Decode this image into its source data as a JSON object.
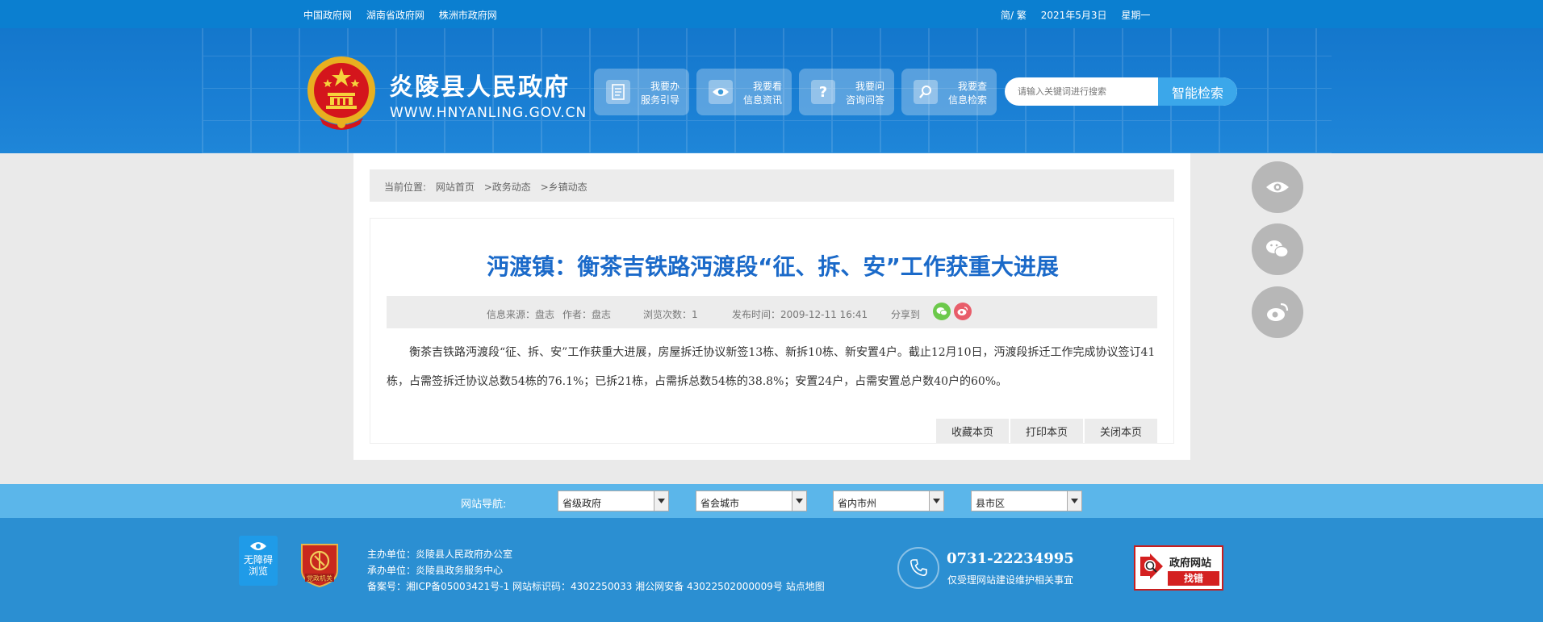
{
  "topbar": {
    "links": [
      "中国政府网",
      "湖南省政府网",
      "株洲市政府网"
    ],
    "lang": "简/ 繁",
    "date": "2021年5月3日",
    "weekday": "星期一"
  },
  "header": {
    "site_name": "炎陵县人民政府",
    "site_url": "WWW.HNYANLING.GOV.CN",
    "services": [
      {
        "line1": "我要办",
        "line2": "服务引导",
        "icon": "document-icon"
      },
      {
        "line1": "我要看",
        "line2": "信息资讯",
        "icon": "eye-icon"
      },
      {
        "line1": "我要问",
        "line2": "咨询问答",
        "icon": "question-icon"
      },
      {
        "line1": "我要查",
        "line2": "信息检索",
        "icon": "magnifier-icon"
      }
    ],
    "search_placeholder": "请输入关键词进行搜索",
    "search_button": "智能检索"
  },
  "breadcrumb": {
    "prefix": "当前位置:",
    "items": [
      "网站首页",
      ">政务动态",
      ">乡镇动态"
    ]
  },
  "article": {
    "title": "沔渡镇：衡茶吉铁路沔渡段“征、拆、安”工作获重大进展",
    "meta": {
      "source": "信息来源：盘志",
      "author": "作者：盘志",
      "views": "浏览次数：1",
      "published": "发布时间：2009-12-11 16:41",
      "share_label": "分享到"
    },
    "body": "衡茶吉铁路沔渡段“征、拆、安”工作获重大进展，房屋拆迁协议新签13栋、新拆10栋、新安置4户。截止12月10日，沔渡段拆迁工作完成协议签订41栋，占需签拆迁协议总数54栋的76.1%；已拆21栋，占需拆总数54栋的38.8%；安置24户，占需安置总户数40户的60%。",
    "actions": [
      "收藏本页",
      "打印本页",
      "关闭本页"
    ]
  },
  "site_nav": {
    "label": "网站导航:",
    "selects": [
      "省级政府",
      "省会城市",
      "省内市州",
      "县市区"
    ]
  },
  "footer": {
    "accessibility_line1": "无障碍",
    "accessibility_line2": "浏览",
    "party_badge": "党政机关",
    "host": "主办单位：炎陵县人民政府办公室",
    "organizer": "承办单位：炎陵县政务服务中心",
    "record": "备案号：湘ICP备05003421号-1 网站标识码：4302250033 湘公网安备 43022502000009号 站点地图",
    "phone": "0731-22234995",
    "phone_note": "仅受理网站建设维护相关事宜",
    "error_title": "政府网站",
    "error_action": "找错"
  },
  "colors": {
    "topbar": "#0b7fd0",
    "header": "#1a7fd4",
    "title": "#1b6ac9",
    "footer": "#2b8fd2",
    "navbar": "#5bb6ea"
  }
}
